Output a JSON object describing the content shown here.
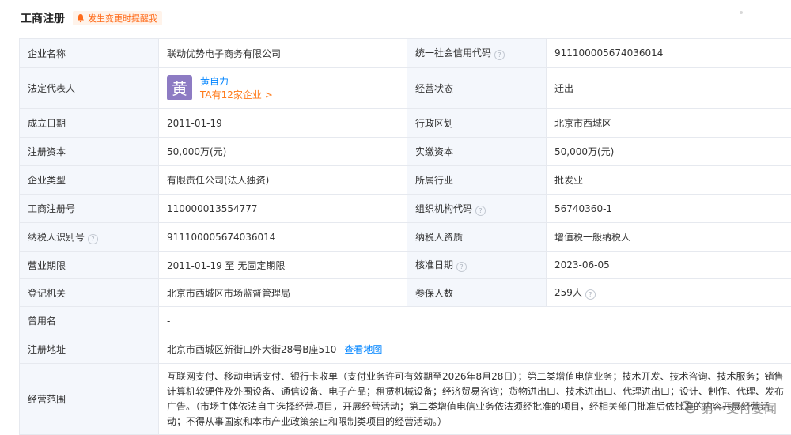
{
  "header": {
    "title": "工商注册",
    "alert_label": "发生变更时提醒我"
  },
  "rows": [
    {
      "label1": "企业名称",
      "value1": "联动优势电子商务有限公司",
      "label2": "统一社会信用代码",
      "value2": "911100005674036014"
    },
    {
      "label1": "法定代表人",
      "label2": "经营状态",
      "value2": "迁出"
    },
    {
      "label1": "成立日期",
      "value1": "2011-01-19",
      "label2": "行政区划",
      "value2": "北京市西城区"
    },
    {
      "label1": "注册资本",
      "value1": "50,000万(元)",
      "label2": "实缴资本",
      "value2": "50,000万(元)"
    },
    {
      "label1": "企业类型",
      "value1": "有限责任公司(法人独资)",
      "label2": "所属行业",
      "value2": "批发业"
    },
    {
      "label1": "工商注册号",
      "value1": "110000013554777",
      "label2": "组织机构代码",
      "value2": "56740360-1"
    },
    {
      "label1": "纳税人识别号",
      "value1": "911100005674036014",
      "label2": "纳税人资质",
      "value2": "增值税一般纳税人"
    },
    {
      "label1": "营业期限",
      "value1": "2011-01-19 至 无固定期限",
      "label2": "核准日期",
      "value2": "2023-06-05"
    },
    {
      "label1": "登记机关",
      "value1": "北京市西城区市场监督管理局",
      "label2": "参保人数",
      "value2": "259人"
    }
  ],
  "legal_rep": {
    "avatar_char": "黄",
    "name": "黄自力",
    "companies_link": "TA有12家企业 >"
  },
  "former_name": {
    "label": "曾用名",
    "value": "-"
  },
  "address": {
    "label": "注册地址",
    "value": "北京市西城区新街口外大街28号B座510",
    "map_link": "查看地图"
  },
  "scope": {
    "label": "经营范围",
    "value": "互联网支付、移动电话支付、银行卡收单（支付业务许可有效期至2026年8月28日）；第二类增值电信业务；技术开发、技术咨询、技术服务；销售计算机软硬件及外围设备、通信设备、电子产品；租赁机械设备；经济贸易咨询；货物进出口、技术进出口、代理进出口；设计、制作、代理、发布广告。（市场主体依法自主选择经营项目，开展经营活动；第二类增值电信业务依法须经批准的项目，经相关部门批准后依批准的内容开展经营活动；不得从事国家和本市产业政策禁止和限制类项目的经营活动。）"
  },
  "help_glyph": "?",
  "watermark": {
    "text": "第一支付要闻"
  },
  "colors": {
    "accent": "#0084ff",
    "orange": "#ff6b1a",
    "label_bg": "#f4f7fc",
    "border": "#e6e9ef",
    "avatar": "#8d7bc3"
  }
}
